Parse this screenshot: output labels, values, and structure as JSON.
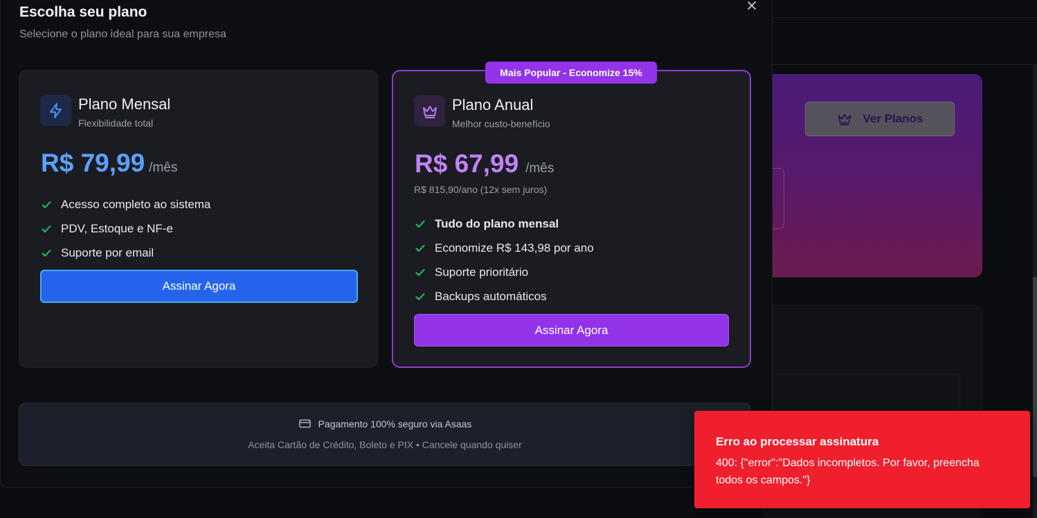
{
  "modal": {
    "title": "Escolha seu plano",
    "subtitle": "Selecione o plano ideal para sua empresa",
    "close_icon": "close-icon"
  },
  "plans": {
    "monthly": {
      "icon": "lightning-icon",
      "name": "Plano Mensal",
      "tagline": "Flexibilidade total",
      "price": "R$ 79,99",
      "period": "/mês",
      "features": [
        "Acesso completo ao sistema",
        "PDV, Estoque e NF-e",
        "Suporte por email"
      ],
      "cta": "Assinar Agora",
      "accent": "#5aa2ff"
    },
    "annual": {
      "badge": "Mais Popular - Economize 15%",
      "icon": "crown-icon",
      "name": "Plano Anual",
      "tagline": "Melhor custo-benefício",
      "price": "R$ 67,99",
      "period": "/mês",
      "note": "R$ 815,90/ano (12x sem juros)",
      "features": [
        "Tudo do plano mensal",
        "Economize R$ 143,98 por ano",
        "Suporte prioritário",
        "Backups automáticos"
      ],
      "cta": "Assinar Agora",
      "accent": "#c183f5"
    }
  },
  "payment": {
    "icon": "credit-card-icon",
    "secure_text": "Pagamento 100% seguro via Asaas",
    "methods_text": "Aceita Cartão de Crédito, Boleto e PIX • Cancele quando quiser"
  },
  "background": {
    "ver_planos_label": "Ver Planos"
  },
  "toast": {
    "title": "Erro ao processar assinatura",
    "message": "400: {\"error\":\"Dados incompletos. Por favor, preencha todos os campos.\"}",
    "color": "#ef1f2e"
  }
}
